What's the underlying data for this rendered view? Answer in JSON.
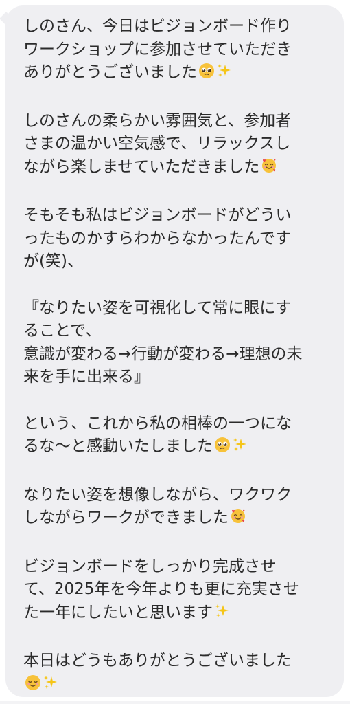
{
  "message": {
    "paragraphs": [
      {
        "lines": [
          "しのさん、今日はビジョンボード作り",
          "ワークショップに参加させていただき",
          "ありがとうございました"
        ],
        "trailing_emojis": [
          "pleading-face-icon",
          "sparkles-icon"
        ]
      },
      {
        "lines": [
          "しのさんの柔らかい雰囲気と、参加者",
          "さまの温かい空気感で、リラックスし",
          "ながら楽しませていただきました"
        ],
        "trailing_emojis": [
          "smiling-face-with-hearts-icon"
        ]
      },
      {
        "lines": [
          "そもそも私はビジョンボードがどうい",
          "ったものかすらわからなかったんです",
          "が(笑)、"
        ],
        "trailing_emojis": []
      },
      {
        "lines": [
          "『なりたい姿を可視化して常に眼にす",
          "ることで、",
          "意識が変わる→行動が変わる→理想の未",
          "来を手に出来る』"
        ],
        "trailing_emojis": []
      },
      {
        "lines": [
          "という、これから私の相棒の一つにな",
          "るな〜と感動いたしました"
        ],
        "trailing_emojis": [
          "pleading-face-icon",
          "sparkles-icon"
        ]
      },
      {
        "lines": [
          "なりたい姿を想像しながら、ワクワク",
          "しながらワークができました"
        ],
        "trailing_emojis": [
          "smiling-face-with-hearts-icon"
        ]
      },
      {
        "lines": [
          "ビジョンボードをしっかり完成させ",
          "て、2025年を今年よりも更に充実させ",
          "た一年にしたいと思います"
        ],
        "trailing_emojis": [
          "sparkles-icon"
        ]
      },
      {
        "lines": [
          "本日はどうもありがとうございました",
          ""
        ],
        "trailing_emojis": [
          "relieved-smiling-face-icon",
          "sparkles-icon"
        ]
      }
    ]
  },
  "colors": {
    "bubble_background": "#efeff2",
    "text": "#2b2b2b",
    "emoji_face": "#f7c23a",
    "sparkle": "#f5c518",
    "heart": "#e8434b"
  }
}
